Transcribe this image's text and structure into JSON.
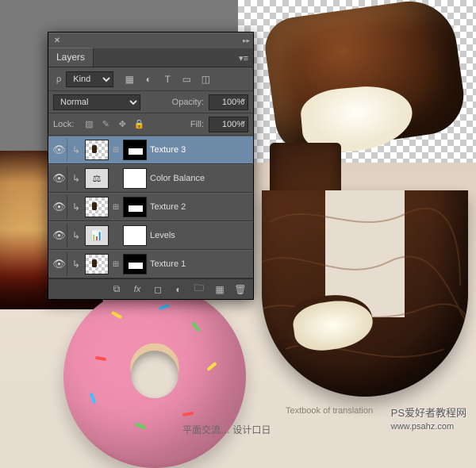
{
  "panel": {
    "title": "Layers",
    "kind_label": "Kind",
    "kind_value": "⌁",
    "filter_icons": [
      "image-filter",
      "adjustment-filter",
      "type-filter",
      "shape-filter",
      "smartobj-filter"
    ],
    "blend_mode": "Normal",
    "opacity_label": "Opacity:",
    "opacity_value": "100%",
    "lock_label": "Lock:",
    "fill_label": "Fill:",
    "fill_value": "100%",
    "layers": [
      {
        "name": "Texture 3",
        "type": "texture",
        "selected": true,
        "linked": true
      },
      {
        "name": "Color Balance",
        "type": "adjust",
        "selected": false,
        "icon": "⚖",
        "linked": false
      },
      {
        "name": "Texture 2",
        "type": "texture",
        "selected": false,
        "linked": true
      },
      {
        "name": "Levels",
        "type": "adjust",
        "selected": false,
        "icon": "📊",
        "linked": false
      },
      {
        "name": "Texture 1",
        "type": "texture",
        "selected": false,
        "linked": true
      }
    ],
    "bottom_icons": [
      "link",
      "fx",
      "mask",
      "adjustment",
      "group",
      "new-layer",
      "trash"
    ]
  },
  "caption": "Textbook of translation",
  "watermark_site": "PS爱好者教程网",
  "watermark_url": "www.psahz.com",
  "watermark_center": "平面交流… 设计口日"
}
